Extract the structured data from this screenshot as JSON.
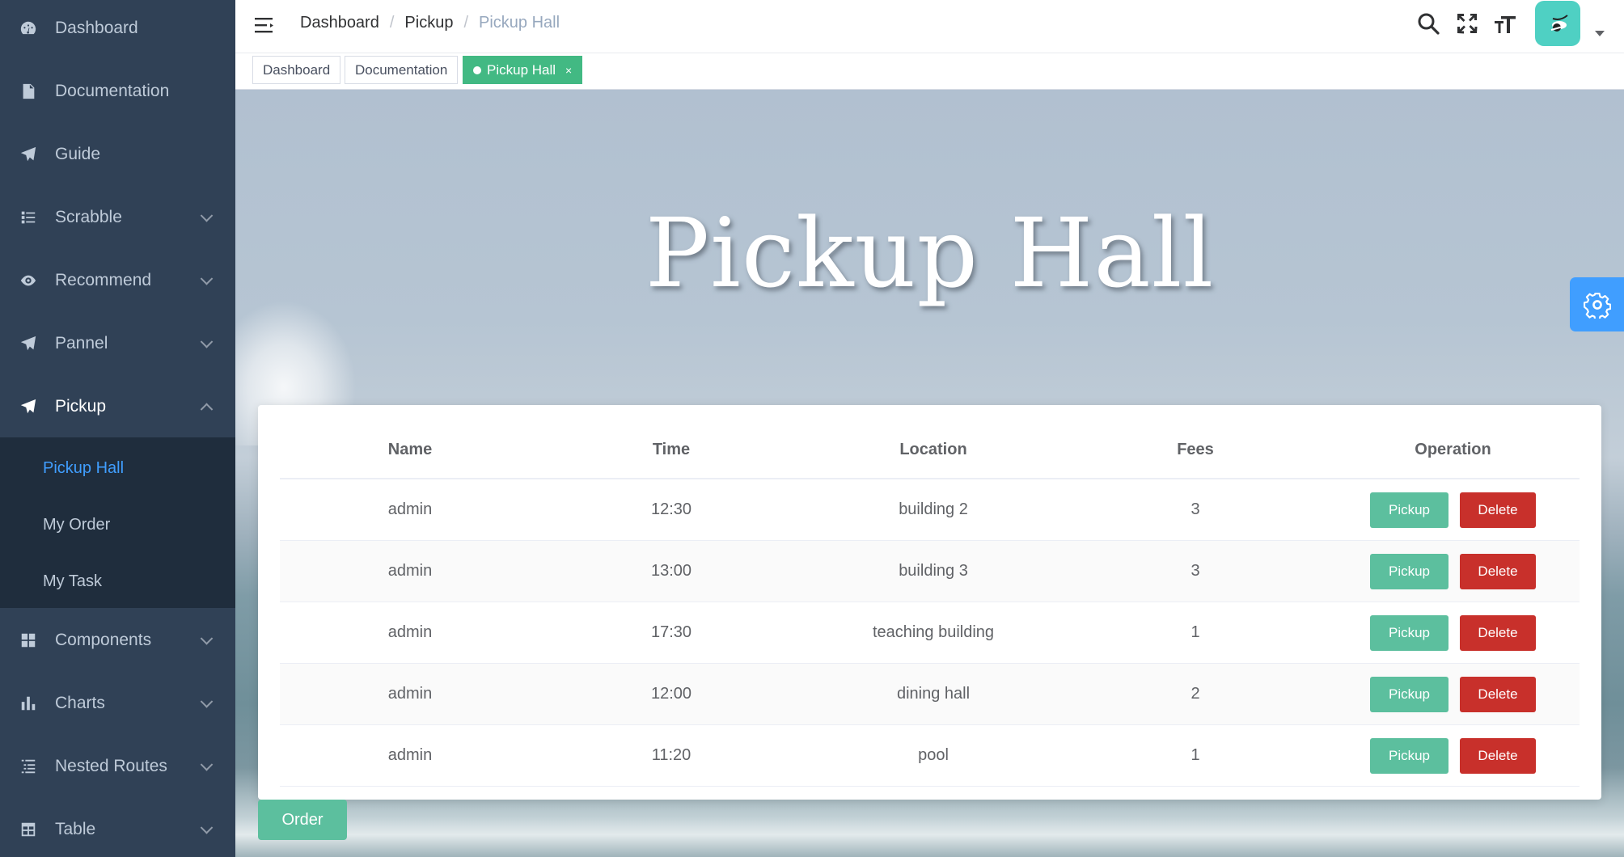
{
  "sidebar": {
    "items": [
      {
        "label": "Dashboard",
        "icon": "dashboard-icon"
      },
      {
        "label": "Documentation",
        "icon": "document-icon"
      },
      {
        "label": "Guide",
        "icon": "paper-plane-icon"
      },
      {
        "label": "Scrabble",
        "icon": "list-icon"
      },
      {
        "label": "Recommend",
        "icon": "eye-icon"
      },
      {
        "label": "Pannel",
        "icon": "paper-plane-icon"
      },
      {
        "label": "Pickup",
        "icon": "paper-plane-icon"
      },
      {
        "label": "Components",
        "icon": "grid-icon"
      },
      {
        "label": "Charts",
        "icon": "bar-chart-icon"
      },
      {
        "label": "Nested Routes",
        "icon": "nested-list-icon"
      },
      {
        "label": "Table",
        "icon": "table-icon"
      }
    ],
    "pickup_submenu": [
      "Pickup Hall",
      "My Order",
      "My Task"
    ],
    "active_submenu": "Pickup Hall"
  },
  "navbar": {
    "breadcrumb": [
      "Dashboard",
      "Pickup",
      "Pickup Hall"
    ],
    "icons": [
      "menu-fold-icon",
      "search-icon",
      "fullscreen-icon",
      "font-size-icon"
    ]
  },
  "tags": [
    {
      "label": "Dashboard",
      "active": false
    },
    {
      "label": "Documentation",
      "active": false
    },
    {
      "label": "Pickup Hall",
      "active": true,
      "close": "×"
    }
  ],
  "hero": {
    "title": "Pickup Hall"
  },
  "table": {
    "columns": [
      "Name",
      "Time",
      "Location",
      "Fees",
      "Operation"
    ],
    "rows": [
      {
        "name": "admin",
        "time": "12:30",
        "location": "building 2",
        "fees": "3"
      },
      {
        "name": "admin",
        "time": "13:00",
        "location": "building 3",
        "fees": "3"
      },
      {
        "name": "admin",
        "time": "17:30",
        "location": "teaching building",
        "fees": "1"
      },
      {
        "name": "admin",
        "time": "12:00",
        "location": "dining hall",
        "fees": "2"
      },
      {
        "name": "admin",
        "time": "11:20",
        "location": "pool",
        "fees": "1"
      }
    ],
    "pickup_label": "Pickup",
    "delete_label": "Delete"
  },
  "order_label": "Order",
  "colors": {
    "sidebar_bg": "#304156",
    "submenu_bg": "#1f2d3d",
    "active_link": "#409eff",
    "tag_active": "#42b983",
    "pickup_button": "#5cbf9e",
    "delete_button": "#c8302b"
  }
}
